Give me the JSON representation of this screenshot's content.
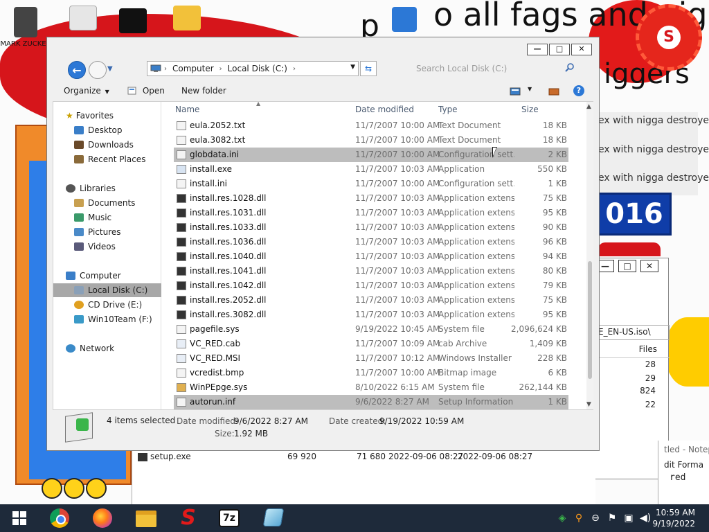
{
  "desktop": {
    "wallpaper_text_1": "o all fags and nigge",
    "wallpaper_text_2": "iggers",
    "wallpaper_frag": "p",
    "badge_letter": "S",
    "banner_lines": [
      "ex with nigga destroyed",
      "ex with nigga destroyed",
      "ex with nigga destroyed"
    ],
    "logo_text": "016",
    "icon_label": "MARK ZUCKER"
  },
  "bg_window": {
    "combo_text": "E_EN-US.iso\\",
    "column_header": "Files",
    "numbers": [
      "28",
      "29",
      "824",
      "22"
    ]
  },
  "bg_window2": {
    "row": {
      "name": "setup.exe",
      "a": "69 920",
      "b": "71 680",
      "c": "2022-09-06 08:27",
      "d": "2022-09-06 08:27"
    }
  },
  "notepad": {
    "title": "tled - Notep",
    "menu": "dit  Forma",
    "text": "red"
  },
  "explorer": {
    "controls": {
      "minimize": "—",
      "maximize": "□",
      "close": "✕"
    },
    "address": {
      "crumbs": [
        "Computer",
        "Local Disk (C:)"
      ]
    },
    "search": {
      "placeholder": "Search Local Disk (C:)"
    },
    "toolbar": {
      "organize": "Organize",
      "open": "Open",
      "new_folder": "New folder"
    },
    "nav": {
      "favorites": "Favorites",
      "desktop": "Desktop",
      "downloads": "Downloads",
      "recent": "Recent Places",
      "libraries": "Libraries",
      "documents": "Documents",
      "music": "Music",
      "pictures": "Pictures",
      "videos": "Videos",
      "computer": "Computer",
      "local_disk": "Local Disk (C:)",
      "cd_drive": "CD Drive (E:)",
      "win10team": "Win10Team (F:)",
      "network": "Network"
    },
    "columns": {
      "name": "Name",
      "date": "Date modified",
      "type": "Type",
      "size": "Size"
    },
    "files": [
      {
        "name": "eula.2052.txt",
        "date": "11/7/2007 10:00 AM",
        "type": "Text Document",
        "size": "18 KB"
      },
      {
        "name": "eula.3082.txt",
        "date": "11/7/2007 10:00 AM",
        "type": "Text Document",
        "size": "18 KB"
      },
      {
        "name": "globdata.ini",
        "date": "11/7/2007 10:00 AM",
        "type": "Configuration sett...",
        "size": "2 KB"
      },
      {
        "name": "install.exe",
        "date": "11/7/2007 10:03 AM",
        "type": "Application",
        "size": "550 KB"
      },
      {
        "name": "install.ini",
        "date": "11/7/2007 10:00 AM",
        "type": "Configuration sett...",
        "size": "1 KB"
      },
      {
        "name": "install.res.1028.dll",
        "date": "11/7/2007 10:03 AM",
        "type": "Application extens...",
        "size": "75 KB"
      },
      {
        "name": "install.res.1031.dll",
        "date": "11/7/2007 10:03 AM",
        "type": "Application extens...",
        "size": "95 KB"
      },
      {
        "name": "install.res.1033.dll",
        "date": "11/7/2007 10:03 AM",
        "type": "Application extens...",
        "size": "90 KB"
      },
      {
        "name": "install.res.1036.dll",
        "date": "11/7/2007 10:03 AM",
        "type": "Application extens...",
        "size": "96 KB"
      },
      {
        "name": "install.res.1040.dll",
        "date": "11/7/2007 10:03 AM",
        "type": "Application extens...",
        "size": "94 KB"
      },
      {
        "name": "install.res.1041.dll",
        "date": "11/7/2007 10:03 AM",
        "type": "Application extens...",
        "size": "80 KB"
      },
      {
        "name": "install.res.1042.dll",
        "date": "11/7/2007 10:03 AM",
        "type": "Application extens...",
        "size": "79 KB"
      },
      {
        "name": "install.res.2052.dll",
        "date": "11/7/2007 10:03 AM",
        "type": "Application extens...",
        "size": "75 KB"
      },
      {
        "name": "install.res.3082.dll",
        "date": "11/7/2007 10:03 AM",
        "type": "Application extens...",
        "size": "95 KB"
      },
      {
        "name": "pagefile.sys",
        "date": "9/19/2022 10:45 AM",
        "type": "System file",
        "size": "2,096,624 KB"
      },
      {
        "name": "VC_RED.cab",
        "date": "11/7/2007 10:09 AM",
        "type": "cab Archive",
        "size": "1,409 KB"
      },
      {
        "name": "VC_RED.MSI",
        "date": "11/7/2007 10:12 AM",
        "type": "Windows Installer ...",
        "size": "228 KB"
      },
      {
        "name": "vcredist.bmp",
        "date": "11/7/2007 10:00 AM",
        "type": "Bitmap image",
        "size": "6 KB"
      },
      {
        "name": "WinPEpge.sys",
        "date": "8/10/2022 6:15 AM",
        "type": "System file",
        "size": "262,144 KB"
      },
      {
        "name": "autorun.inf",
        "date": "9/6/2022 8:27 AM",
        "type": "Setup Information",
        "size": "1 KB"
      }
    ],
    "details": {
      "selected": "4 items selected",
      "date_modified_label": "Date modified:",
      "date_modified": "9/6/2022 8:27 AM",
      "date_created_label": "Date created:",
      "date_created": "9/19/2022 10:59 AM",
      "size_label": "Size:",
      "size": "1.92 MB"
    }
  },
  "taskbar": {
    "zip_label": "7z",
    "s_label": "S",
    "time": "10:59 AM",
    "date": "9/19/2022"
  }
}
